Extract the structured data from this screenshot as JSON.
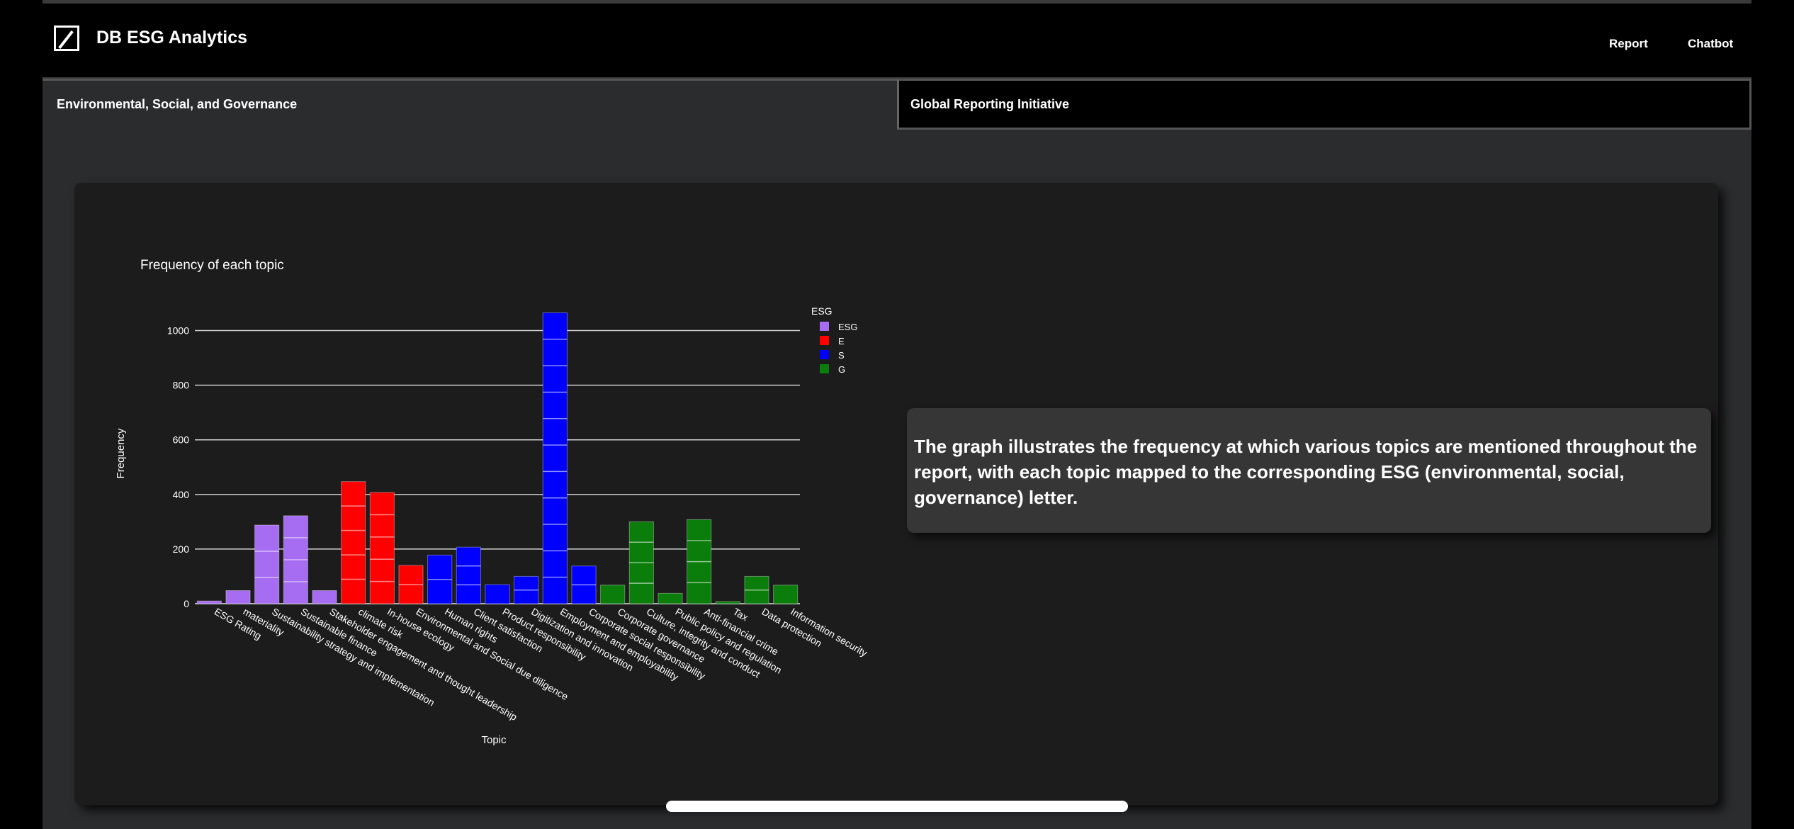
{
  "navbar": {
    "brand": "DB ESG Analytics",
    "links": [
      "Report",
      "Chatbot"
    ]
  },
  "tabs": [
    {
      "label": "Environmental, Social, and Governance",
      "active": true
    },
    {
      "label": "Global Reporting Initiative",
      "active": false
    }
  ],
  "description": "The graph illustrates the frequency at which various topics are mentioned throughout the report, with each topic mapped to the corresponding ESG (environmental, social, governance) letter.",
  "colors": {
    "ESG": "#a66cf2",
    "E": "#ff0000",
    "S": "#0000ff",
    "G": "#0a7d0a"
  },
  "chart_data": {
    "type": "bar",
    "title": "Frequency of each topic",
    "xlabel": "Topic",
    "ylabel": "Frequency",
    "ylim": [
      0,
      1100
    ],
    "yticks": [
      0,
      200,
      400,
      600,
      800,
      1000
    ],
    "grid": true,
    "legend": {
      "title": "ESG",
      "position": "top-right",
      "entries": [
        "ESG",
        "E",
        "S",
        "G"
      ]
    },
    "categories": [
      "ESG Rating",
      "materiality",
      "Sustainability strategy and implementation",
      "Sustainable finance",
      "Stakeholder engagement and thought leadership",
      "climate risk",
      "In-house ecology",
      "Environmental and Social due diligence",
      "Human rights",
      "Client satisfaction",
      "Product responsibility",
      "Digitization and innovation",
      "Employment and employability",
      "Corporate social responsibility",
      "Corporate governance",
      "Culture, integrity and conduct",
      "Public policy and regulation",
      "Anti-financial crime",
      "Tax",
      "Data protection",
      "Information security"
    ],
    "values": [
      10,
      48,
      288,
      322,
      48,
      447,
      407,
      140,
      178,
      207,
      70,
      100,
      1065,
      138,
      68,
      300,
      38,
      308,
      8,
      100,
      68
    ],
    "esg": [
      "ESG",
      "ESG",
      "ESG",
      "ESG",
      "ESG",
      "E",
      "E",
      "E",
      "S",
      "S",
      "S",
      "S",
      "S",
      "S",
      "G",
      "G",
      "G",
      "G",
      "G",
      "G",
      "G"
    ]
  }
}
